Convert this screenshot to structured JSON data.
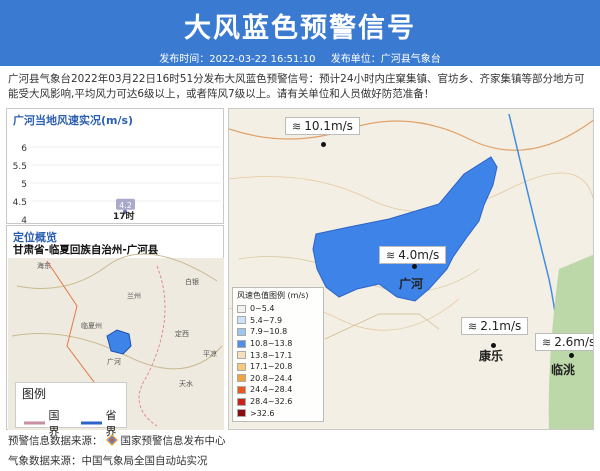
{
  "header": {
    "title": "大风蓝色预警信号",
    "time_label": "发布时间：2022-03-22 16:51:10",
    "unit_label": "发布单位：广河县气象台"
  },
  "description": "广河县气象台2022年03月22日16时51分发布大风蓝色预警信号：预计24小时内庄窠集镇、官坊乡、齐家集镇等部分地方可能受大风影响,平均风力可达6级以上，或者阵风7级以上。请有关单位和人员做好防范准备！",
  "wind_chart": {
    "title": "广河当地风速实况(m/s)",
    "y_ticks": [
      "6",
      "5.5",
      "5",
      "4.5",
      "4"
    ],
    "x_tick": "17时",
    "point_label": "4.2"
  },
  "chart_data": {
    "type": "scatter",
    "title": "广河当地风速实况(m/s)",
    "categories": [
      "17时"
    ],
    "values": [
      4.2
    ],
    "ylim": [
      4,
      6
    ]
  },
  "location": {
    "title": "定位概览",
    "path": "甘肃省-临夏回族自治州-广河县",
    "map_labels": [
      "海东",
      "兰州",
      "临夏州",
      "白银",
      "定西",
      "天水",
      "平凉",
      "广河"
    ],
    "legend_title": "图例",
    "legend_country": "国界",
    "legend_province": "省界"
  },
  "map": {
    "stations": [
      {
        "speed": "10.1m/s",
        "city": ""
      },
      {
        "speed": "4.0m/s",
        "city": "广河"
      },
      {
        "speed": "2.1m/s",
        "city": "康乐"
      },
      {
        "speed": "2.6m/s",
        "city": "临洮"
      }
    ],
    "legend_title": "风速色值图例 (m/s)",
    "legend": [
      {
        "label": "0~5.4",
        "color": "#f2f2f2"
      },
      {
        "label": "5.4~7.9",
        "color": "#cfe3f7"
      },
      {
        "label": "7.9~10.8",
        "color": "#9cc8f0"
      },
      {
        "label": "10.8~13.8",
        "color": "#4f8fe6"
      },
      {
        "label": "13.8~17.1",
        "color": "#f7e1b8"
      },
      {
        "label": "17.1~20.8",
        "color": "#f6c97e"
      },
      {
        "label": "20.8~24.4",
        "color": "#f2a43c"
      },
      {
        "label": "24.4~28.4",
        "color": "#e85a1e"
      },
      {
        "label": "28.4~32.6",
        "color": "#c9221b"
      },
      {
        "label": ">32.6",
        "color": "#8a0c10"
      }
    ]
  },
  "footer": {
    "source1_prefix": "预警信息数据来源：",
    "source1_name": "国家预警信息发布中心",
    "source2": "气象数据来源：中国气象局全国自动站实况"
  },
  "colors": {
    "header_bg": "#3a7ad1",
    "warning_area": "#3e84e8",
    "accent_text": "#2b5fb0"
  }
}
